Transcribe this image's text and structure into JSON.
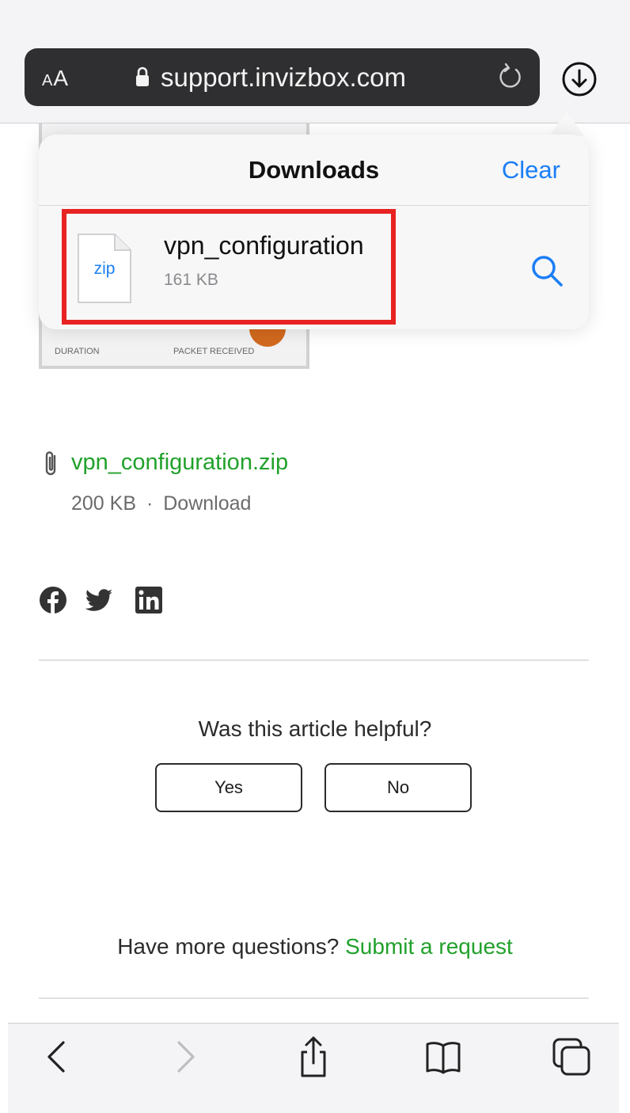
{
  "browser": {
    "aa_label_small": "A",
    "aa_label_large": "A",
    "url": "support.invizbox.com"
  },
  "downloads": {
    "title": "Downloads",
    "clear_label": "Clear",
    "item": {
      "icon_text": "zip",
      "name": "vpn_configuration",
      "size": "161 KB"
    }
  },
  "background_image": {
    "duration_label": "DURATION",
    "packet_label": "PACKET RECEIVED"
  },
  "attachment": {
    "link_text": "vpn_configuration.zip",
    "meta_size": "200 KB",
    "meta_sep": "·",
    "meta_action": "Download"
  },
  "social": [
    "facebook-icon",
    "twitter-icon",
    "linkedin-icon"
  ],
  "feedback": {
    "question": "Was this article helpful?",
    "yes_label": "Yes",
    "no_label": "No"
  },
  "more_questions": {
    "text": "Have more questions?",
    "link": "Submit a request"
  },
  "colors": {
    "accent_blue": "#1b7ef5",
    "link_green": "#21a12b",
    "highlight_red": "#e82222"
  }
}
